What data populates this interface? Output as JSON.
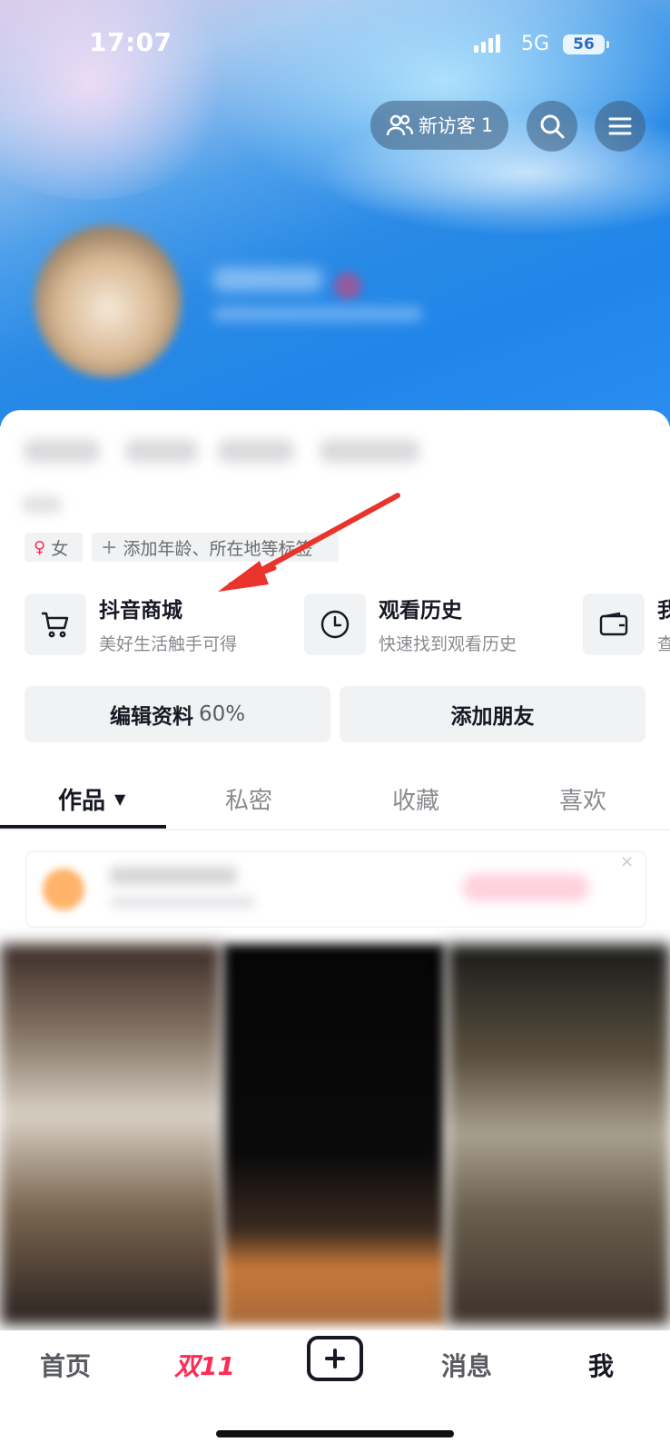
{
  "status_bar": {
    "time": "17:07",
    "network": "5G",
    "battery": "56"
  },
  "header": {
    "visitor_label": "新访客",
    "visitor_count": "1"
  },
  "profile": {
    "gender_tag": "女",
    "add_tags_label": "添加年龄、所在地等标签"
  },
  "features": [
    {
      "title": "抖音商城",
      "subtitle": "美好生活触手可得",
      "icon": "cart-icon"
    },
    {
      "title": "观看历史",
      "subtitle": "快速找到观看历史",
      "icon": "clock-icon"
    },
    {
      "title": "我",
      "subtitle": "查",
      "icon": "wallet-icon"
    }
  ],
  "actions": {
    "edit_label": "编辑资料",
    "edit_progress": "60%",
    "add_friend_label": "添加朋友"
  },
  "tabs": [
    {
      "label": "作品",
      "active": true
    },
    {
      "label": "私密",
      "active": false
    },
    {
      "label": "收藏",
      "active": false
    },
    {
      "label": "喜欢",
      "active": false
    }
  ],
  "bottom_nav": {
    "home": "首页",
    "promo": "双11",
    "messages": "消息",
    "me": "我"
  },
  "colors": {
    "accent_pink": "#fe2c55",
    "text_primary": "#161823",
    "annotation_red": "#e8342c"
  }
}
